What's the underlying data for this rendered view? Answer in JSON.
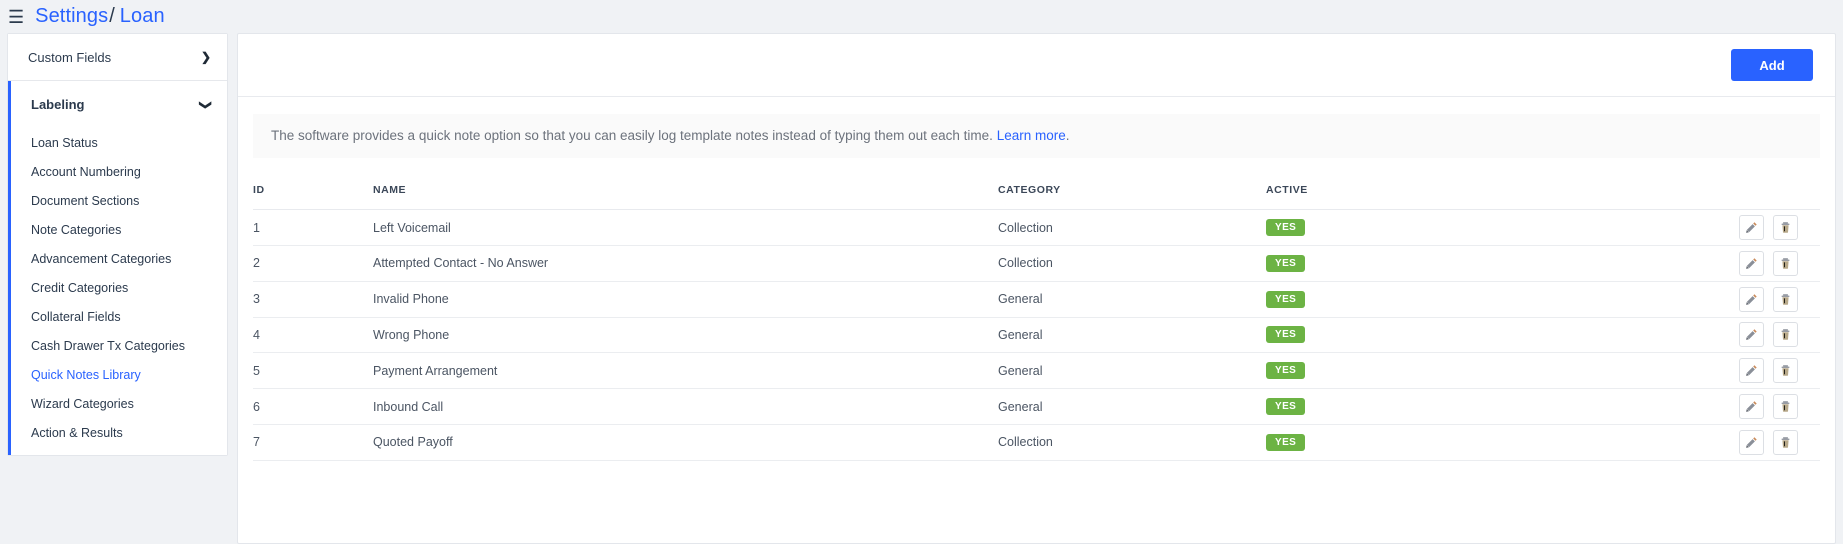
{
  "header": {
    "menu_icon": "hamburger-icon",
    "breadcrumb_root": "Settings",
    "breadcrumb_separator": "/",
    "breadcrumb_current": "Loan"
  },
  "sidebar": {
    "sections": [
      {
        "label": "Custom Fields",
        "chevron": "chevron-right-icon",
        "expanded": false,
        "links": []
      },
      {
        "label": "Labeling",
        "chevron": "chevron-down-icon",
        "expanded": true,
        "links": [
          {
            "label": "Loan Status",
            "selected": false
          },
          {
            "label": "Account Numbering",
            "selected": false
          },
          {
            "label": "Document Sections",
            "selected": false
          },
          {
            "label": "Note Categories",
            "selected": false
          },
          {
            "label": "Advancement Categories",
            "selected": false
          },
          {
            "label": "Credit Categories",
            "selected": false
          },
          {
            "label": "Collateral Fields",
            "selected": false
          },
          {
            "label": "Cash Drawer Tx Categories",
            "selected": false
          },
          {
            "label": "Quick Notes Library",
            "selected": true
          },
          {
            "label": "Wizard Categories",
            "selected": false
          },
          {
            "label": "Action & Results",
            "selected": false
          }
        ]
      }
    ]
  },
  "toolbar": {
    "add_label": "Add"
  },
  "notice": {
    "text": "The software provides a quick note option so that you can easily log template notes instead of typing them out each time.",
    "link_label": "Learn more",
    "trailing": "."
  },
  "table": {
    "columns": [
      "ID",
      "NAME",
      "CATEGORY",
      "ACTIVE"
    ],
    "rows": [
      {
        "id": "1",
        "name": "Left Voicemail",
        "category": "Collection",
        "active": "YES"
      },
      {
        "id": "2",
        "name": "Attempted Contact - No Answer",
        "category": "Collection",
        "active": "YES"
      },
      {
        "id": "3",
        "name": "Invalid Phone",
        "category": "General",
        "active": "YES"
      },
      {
        "id": "4",
        "name": "Wrong Phone",
        "category": "General",
        "active": "YES"
      },
      {
        "id": "5",
        "name": "Payment Arrangement",
        "category": "General",
        "active": "YES"
      },
      {
        "id": "6",
        "name": "Inbound Call",
        "category": "General",
        "active": "YES"
      },
      {
        "id": "7",
        "name": "Quoted Payoff",
        "category": "Collection",
        "active": "YES"
      }
    ],
    "row_actions": [
      {
        "icon": "edit-pencil-icon"
      },
      {
        "icon": "delete-trash-icon"
      }
    ]
  },
  "colors": {
    "accent_blue": "#2962ff",
    "badge_green": "#6cb344",
    "page_bg": "#f0f2f5",
    "card_bg": "#ffffff"
  }
}
